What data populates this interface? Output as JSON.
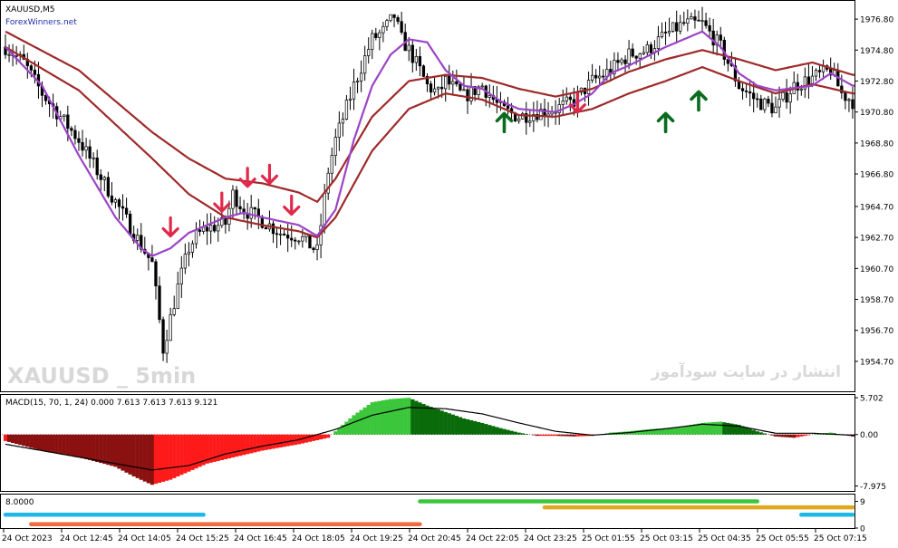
{
  "header": {
    "symbol": "XAUUSD,M5",
    "site": "ForexWinners.net"
  },
  "watermark": {
    "left": "XAUUSD _ 5min",
    "right": "انتشار در سایت سودآموز"
  },
  "colors": {
    "bull_candle": "#ffffff",
    "bear_candle": "#000000",
    "band": "#9e2a2a",
    "fast_ma": "#9b44c6",
    "sell_arrow": "#e0294a",
    "buy_arrow": "#0a6b1e",
    "macd_neg_dark": "#8b1010",
    "macd_neg": "#ff1a1a",
    "macd_pos_light": "#3bc63b",
    "macd_pos_dark": "#0a6b0a",
    "signal": "#000000",
    "bar_cyan": "#1cb8e8",
    "bar_orange": "#f06a3c",
    "bar_green": "#3bc63b",
    "bar_gold": "#e0a81e"
  },
  "chart_data": [
    {
      "type": "candlestick",
      "title": "XAUUSD,M5",
      "ylim": [
        1953.0,
        1977.8
      ],
      "y_ticks": [
        "1976.80",
        "1974.80",
        "1972.80",
        "1970.80",
        "1968.80",
        "1966.80",
        "1964.70",
        "1962.70",
        "1960.70",
        "1958.70",
        "1956.70",
        "1954.70"
      ],
      "y_tick_values": [
        1976.8,
        1974.8,
        1972.8,
        1970.8,
        1968.8,
        1966.8,
        1964.7,
        1962.7,
        1960.7,
        1958.7,
        1956.7,
        1954.7
      ],
      "x_ticks": [
        "24 Oct 2023",
        "24 Oct 12:45",
        "24 Oct 14:05",
        "24 Oct 15:25",
        "24 Oct 16:45",
        "24 Oct 18:05",
        "24 Oct 19:25",
        "24 Oct 20:45",
        "24 Oct 22:05",
        "24 Oct 23:25",
        "25 Oct 01:55",
        "25 Oct 03:15",
        "25 Oct 04:35",
        "25 Oct 05:55",
        "25 Oct 07:15"
      ],
      "close_profile": {
        "x": [
          0,
          5,
          10,
          20,
          25,
          30,
          35,
          40,
          43,
          47,
          50,
          52,
          55,
          60,
          62,
          65,
          70,
          75,
          80,
          85,
          88,
          90,
          95,
          100,
          103,
          106,
          108,
          110,
          113,
          115,
          118,
          120,
          125,
          130,
          135,
          140,
          145,
          150,
          155,
          160,
          165,
          170,
          175,
          180,
          185,
          190,
          195,
          200,
          205,
          210,
          215,
          220,
          225,
          228,
          231
        ],
        "y": [
          1975.0,
          1974.0,
          1972.0,
          1969.0,
          1967.0,
          1965.0,
          1963.0,
          1961.0,
          1955.5,
          1959.5,
          1962.0,
          1962.8,
          1963.3,
          1963.6,
          1965.5,
          1964.5,
          1963.8,
          1963.0,
          1962.8,
          1961.8,
          1967.0,
          1969.0,
          1972.5,
          1975.5,
          1976.0,
          1977.0,
          1975.5,
          1974.8,
          1973.5,
          1972.5,
          1972.0,
          1972.8,
          1971.8,
          1972.5,
          1971.0,
          1970.5,
          1970.8,
          1971.0,
          1971.5,
          1972.8,
          1973.5,
          1974.5,
          1974.8,
          1975.8,
          1976.5,
          1976.5,
          1975.0,
          1972.5,
          1971.5,
          1971.0,
          1972.5,
          1973.0,
          1973.5,
          1972.0,
          1971.5
        ]
      },
      "series": [
        {
          "name": "upper band",
          "x": [
            0,
            20,
            40,
            50,
            60,
            70,
            80,
            85,
            90,
            100,
            110,
            120,
            130,
            140,
            150,
            160,
            170,
            180,
            190,
            200,
            210,
            220,
            231
          ],
          "y": [
            1976.0,
            1973.5,
            1969.5,
            1967.8,
            1966.5,
            1966.2,
            1965.6,
            1965.0,
            1966.5,
            1970.5,
            1972.8,
            1973.2,
            1973.0,
            1972.3,
            1971.8,
            1972.3,
            1973.4,
            1974.2,
            1974.8,
            1974.2,
            1973.5,
            1974.0,
            1973.2
          ]
        },
        {
          "name": "lower band",
          "x": [
            0,
            20,
            40,
            50,
            60,
            70,
            80,
            85,
            90,
            100,
            110,
            120,
            130,
            140,
            150,
            160,
            170,
            180,
            190,
            200,
            210,
            220,
            231
          ],
          "y": [
            1975.0,
            1972.2,
            1967.8,
            1965.5,
            1964.0,
            1963.5,
            1963.1,
            1962.7,
            1964.0,
            1968.3,
            1971.0,
            1972.0,
            1971.6,
            1970.6,
            1970.5,
            1971.0,
            1972.0,
            1972.8,
            1973.7,
            1972.8,
            1972.0,
            1972.6,
            1972.0
          ]
        },
        {
          "name": "fast ma",
          "x": [
            0,
            10,
            20,
            30,
            37,
            40,
            45,
            50,
            55,
            60,
            65,
            70,
            80,
            85,
            90,
            95,
            100,
            105,
            110,
            115,
            120,
            125,
            130,
            135,
            140,
            150,
            155,
            160,
            165,
            170,
            180,
            190,
            195,
            200,
            205,
            210,
            220,
            225,
            231
          ],
          "y": [
            1975.0,
            1972.5,
            1968.0,
            1964.0,
            1962.0,
            1961.5,
            1962.0,
            1963.0,
            1963.5,
            1964.0,
            1964.3,
            1964.0,
            1963.5,
            1962.8,
            1964.5,
            1969.0,
            1972.5,
            1974.5,
            1975.5,
            1975.3,
            1973.5,
            1972.5,
            1972.3,
            1971.5,
            1971.0,
            1970.8,
            1971.3,
            1972.0,
            1973.3,
            1973.8,
            1975.0,
            1976.0,
            1975.0,
            1973.3,
            1972.5,
            1972.2,
            1972.5,
            1973.3,
            1972.5
          ]
        }
      ],
      "signals": [
        {
          "type": "sell",
          "x": 45,
          "y": 1962.8
        },
        {
          "type": "sell",
          "x": 59,
          "y": 1964.4
        },
        {
          "type": "sell",
          "x": 66,
          "y": 1966.0
        },
        {
          "type": "sell",
          "x": 72,
          "y": 1966.2
        },
        {
          "type": "sell",
          "x": 78,
          "y": 1964.2
        },
        {
          "type": "buy",
          "x": 136,
          "y": 1970.7
        },
        {
          "type": "sell",
          "x": 156,
          "y": 1970.8
        },
        {
          "type": "buy",
          "x": 180,
          "y": 1970.7
        },
        {
          "type": "buy",
          "x": 189,
          "y": 1972.1
        }
      ]
    },
    {
      "type": "bar",
      "title": "MACD(15, 70, 1, 24) 0.000 7.613 7.613 7.613 9.121",
      "ylim": [
        -8.6,
        6.0
      ],
      "y_ticks": [
        "5.702",
        "0.00",
        "-7.975"
      ],
      "y_tick_values": [
        5.702,
        0.0,
        -7.975
      ],
      "histogram": {
        "x": [
          0,
          10,
          20,
          30,
          35,
          40,
          45,
          55,
          70,
          80,
          88,
          90,
          95,
          100,
          105,
          110,
          115,
          120,
          125,
          130,
          135,
          140,
          145,
          150,
          155,
          160,
          165,
          170,
          175,
          180,
          185,
          190,
          195,
          200,
          205,
          210,
          215,
          220,
          225,
          231
        ],
        "y": [
          -1.0,
          -2.5,
          -3.5,
          -5.0,
          -6.5,
          -7.8,
          -7.0,
          -4.5,
          -2.5,
          -1.5,
          -0.5,
          0.5,
          3.0,
          5.0,
          5.5,
          5.7,
          4.5,
          3.5,
          2.5,
          1.8,
          1.0,
          0.3,
          -0.2,
          -0.2,
          -0.3,
          -0.2,
          0.3,
          0.5,
          0.8,
          1.0,
          1.3,
          1.8,
          2.0,
          1.5,
          0.5,
          -0.3,
          -0.5,
          0.0,
          0.3,
          -0.3
        ]
      },
      "signal_line": {
        "x": [
          0,
          20,
          40,
          50,
          60,
          70,
          80,
          90,
          100,
          110,
          120,
          130,
          140,
          150,
          160,
          170,
          180,
          190,
          200,
          210,
          220,
          231
        ],
        "y": [
          -1.5,
          -3.5,
          -5.5,
          -4.8,
          -3.0,
          -1.8,
          -0.8,
          0.8,
          3.0,
          4.2,
          4.0,
          3.2,
          1.8,
          0.5,
          -0.1,
          0.3,
          0.9,
          1.6,
          1.3,
          0.2,
          0.2,
          -0.1
        ]
      }
    },
    {
      "type": "bar",
      "title": "8.0000",
      "ylim": [
        0,
        11
      ],
      "y_ticks": [
        "9",
        "0"
      ],
      "y_tick_values": [
        9,
        0
      ],
      "segments": [
        {
          "color": "cyan",
          "x": [
            0,
            54
          ],
          "y": 4.5
        },
        {
          "color": "orange",
          "x": [
            7,
            113
          ],
          "y": 1.3
        },
        {
          "color": "green",
          "x": [
            113,
            205
          ],
          "y": 9.0
        },
        {
          "color": "gold",
          "x": [
            147,
            231
          ],
          "y": 7.0
        },
        {
          "color": "cyan",
          "x": [
            217,
            231
          ],
          "y": 4.5
        }
      ]
    }
  ]
}
